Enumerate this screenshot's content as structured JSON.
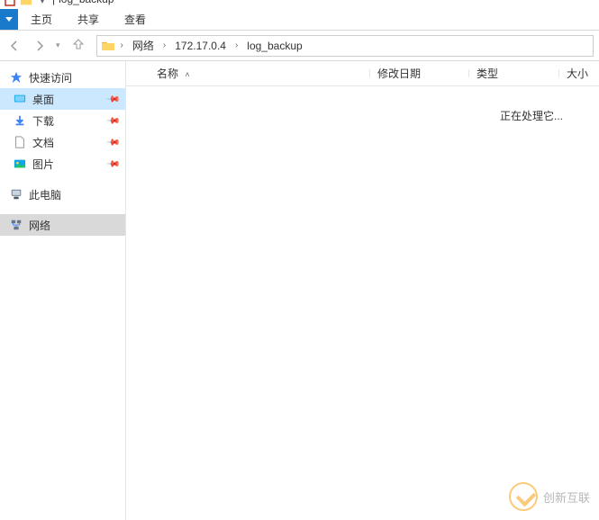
{
  "title": {
    "text": "log_backup",
    "divider": "|"
  },
  "ribbon": {
    "tabs": [
      "主页",
      "共享",
      "查看"
    ]
  },
  "breadcrumb": {
    "items": [
      "网络",
      "172.17.0.4",
      "log_backup"
    ]
  },
  "sidebar": {
    "quick_access": "快速访问",
    "desktop": "桌面",
    "downloads": "下载",
    "documents": "文档",
    "pictures": "图片",
    "this_pc": "此电脑",
    "network": "网络"
  },
  "columns": {
    "name": "名称",
    "date_modified": "修改日期",
    "type": "类型",
    "size": "大小"
  },
  "content": {
    "processing": "正在处理它..."
  },
  "watermark": {
    "text": "创新互联"
  }
}
